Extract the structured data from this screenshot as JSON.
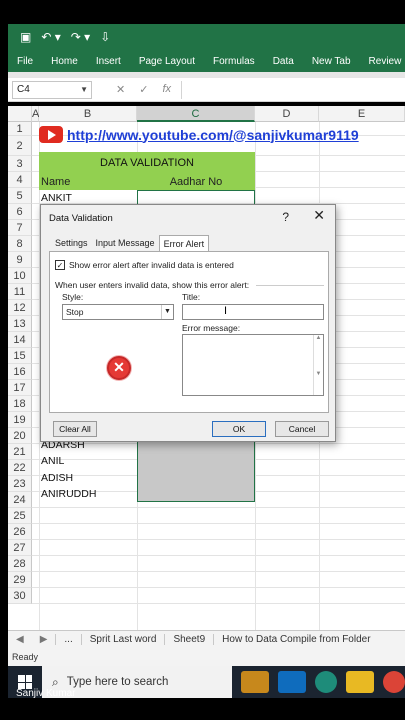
{
  "ribbon": {
    "tabs": [
      "File",
      "Home",
      "Insert",
      "Page Layout",
      "Formulas",
      "Data",
      "New Tab",
      "Review"
    ]
  },
  "formula_bar": {
    "name_box": "C4",
    "fx": "fx",
    "cancel": "✕",
    "enter": "✓"
  },
  "columns": [
    "A",
    "B",
    "C",
    "D",
    "E"
  ],
  "rows": [
    "1",
    "2",
    "3",
    "4",
    "5",
    "6",
    "7",
    "8",
    "9",
    "10",
    "11",
    "12",
    "13",
    "14",
    "15",
    "16",
    "17",
    "18",
    "19",
    "20",
    "21",
    "22",
    "23",
    "24",
    "25",
    "26",
    "27",
    "28",
    "29",
    "30"
  ],
  "sheet": {
    "link": "http://www.youtube.com/@sanjivkumar9119",
    "header": "DATA VALIDATION",
    "col_name": "Name",
    "col_aadhar": "Aadhar No",
    "names_top": [
      "ANKIT"
    ],
    "names_bottom": [
      "ADARSH",
      "ANIL",
      "ADISH",
      "ANIRUDDH"
    ]
  },
  "dialog": {
    "title": "Data Validation",
    "help": "?",
    "close": "✕",
    "tabs": [
      "Settings",
      "Input Message",
      "Error Alert"
    ],
    "active_tab": "Error Alert",
    "show_alert_label": "Show error alert after invalid data is entered",
    "show_alert_checked": true,
    "instruction": "When user enters invalid data, show this error alert:",
    "style_label": "Style:",
    "style_value": "Stop",
    "title_label": "Title:",
    "title_value": "",
    "message_label": "Error message:",
    "message_value": "",
    "clear_all": "Clear All",
    "ok": "OK",
    "cancel": "Cancel"
  },
  "sheet_tabs": {
    "more": "...",
    "items": [
      "Sprit Last word",
      "Sheet9",
      "How to Data Compile from Folder"
    ]
  },
  "status": "Ready",
  "taskbar": {
    "search_placeholder": "Type here to search"
  },
  "author": "Sanjiv Kumar",
  "colors": {
    "excel_green": "#217346",
    "header_green": "#92d050",
    "link_blue": "#1f3fd6"
  }
}
